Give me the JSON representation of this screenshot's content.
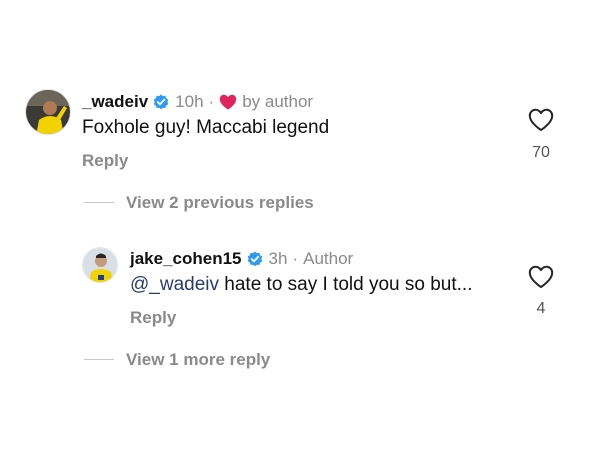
{
  "comment": {
    "username": "_wadeiv",
    "time": "10h",
    "separator": "·",
    "liked_by_author_label": "by author",
    "text": "Foxhole guy! Maccabi legend",
    "reply_label": "Reply",
    "like_count": "70",
    "view_previous_label": "View 2 previous replies"
  },
  "reply": {
    "username": "jake_cohen15",
    "time": "3h",
    "separator": "·",
    "role_label": "Author",
    "mention": "@_wadeiv",
    "text": " hate to say I told you so but...",
    "reply_label": "Reply",
    "like_count": "4",
    "view_more_label": "View 1 more reply"
  },
  "colors": {
    "verified_badge": "#2f9bf0",
    "author_heart": "#e0245e",
    "muted_text": "#8a8a8a",
    "mention": "#2a3b6e"
  },
  "icons": {
    "verified": "verified-badge-icon",
    "author_heart": "heart-filled-icon",
    "like": "heart-outline-icon"
  }
}
